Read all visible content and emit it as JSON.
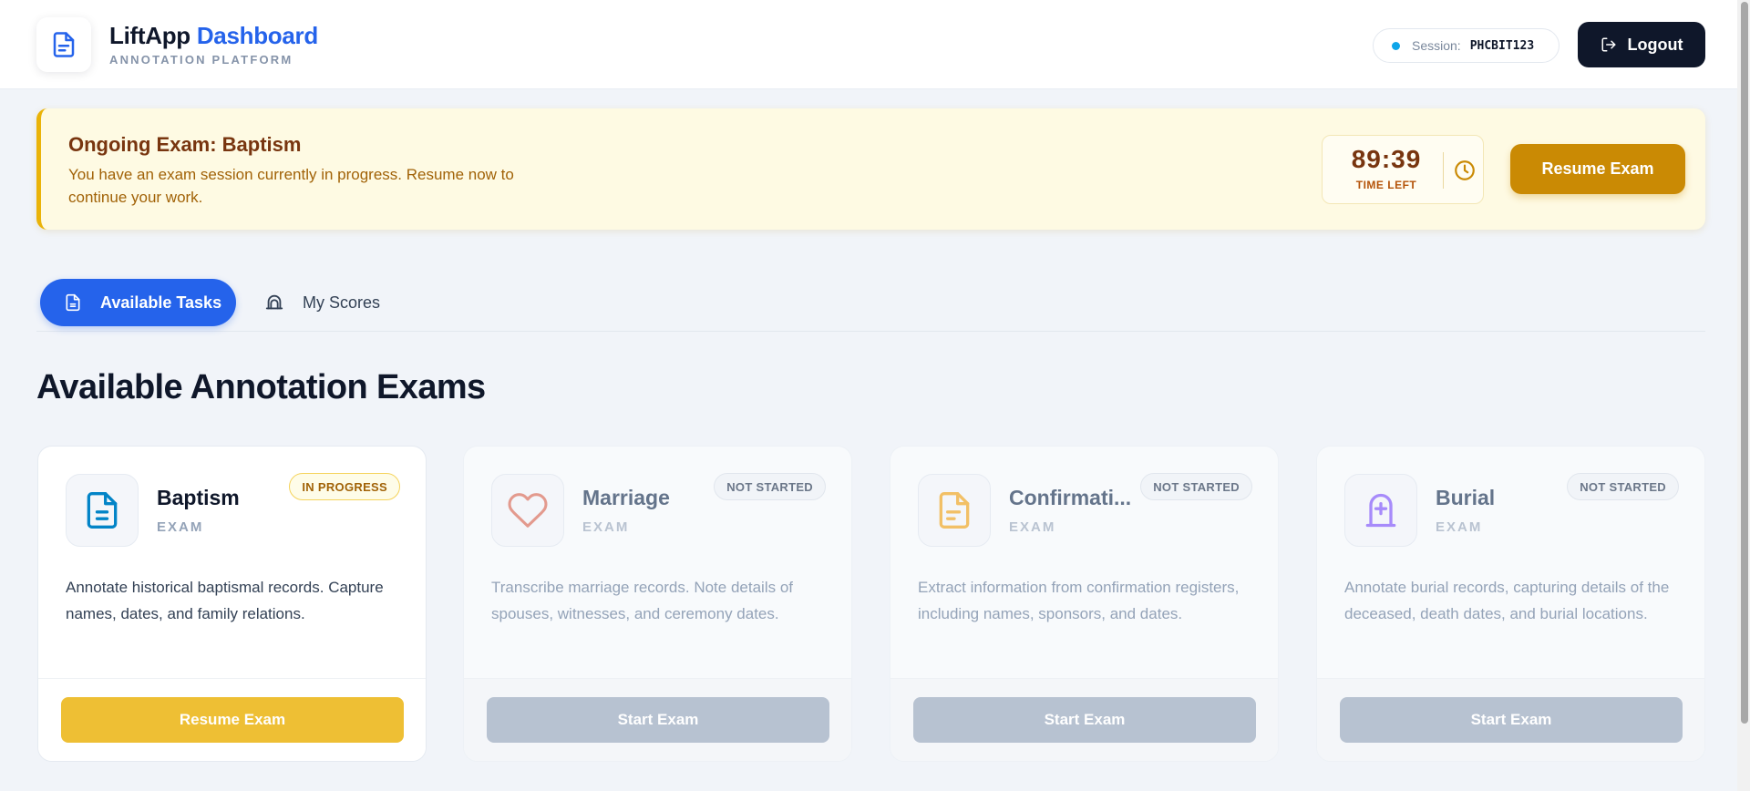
{
  "header": {
    "brand_title": "LiftApp",
    "brand_title_accent": "Dashboard",
    "brand_subtitle": "ANNOTATION PLATFORM",
    "session_label": "Session:",
    "session_code": "PHCBIT123",
    "logout_label": "Logout"
  },
  "banner": {
    "title": "Ongoing Exam: Baptism",
    "description": "You have an exam session currently in progress. Resume now to continue your work.",
    "timer_value": "89:39",
    "timer_label": "TIME LEFT",
    "resume_label": "Resume Exam"
  },
  "tabs": {
    "available": "Available Tasks",
    "scores": "My Scores"
  },
  "section_title": "Available Annotation Exams",
  "cards": [
    {
      "name": "Baptism",
      "type": "EXAM",
      "status": "IN PROGRESS",
      "description": "Annotate historical baptismal records. Capture names, dates, and family relations.",
      "button": "Resume Exam",
      "icon": "document-icon"
    },
    {
      "name": "Marriage",
      "type": "EXAM",
      "status": "NOT STARTED",
      "description": "Transcribe marriage records. Note details of spouses, witnesses, and ceremony dates.",
      "button": "Start Exam",
      "icon": "heart-icon"
    },
    {
      "name": "Confirmati...",
      "type": "EXAM",
      "status": "NOT STARTED",
      "description": "Extract information from confirmation registers, including names, sponsors, and dates.",
      "button": "Start Exam",
      "icon": "file-text-icon"
    },
    {
      "name": "Burial",
      "type": "EXAM",
      "status": "NOT STARTED",
      "description": "Annotate burial records, capturing details of the deceased, death dates, and burial locations.",
      "button": "Start Exam",
      "icon": "tombstone-icon"
    }
  ],
  "colors": {
    "primary": "#2563eb",
    "dark": "#0f172a",
    "amber": "#ca8a04",
    "yellow": "#eebf34",
    "disabled": "#b7c2d1"
  }
}
